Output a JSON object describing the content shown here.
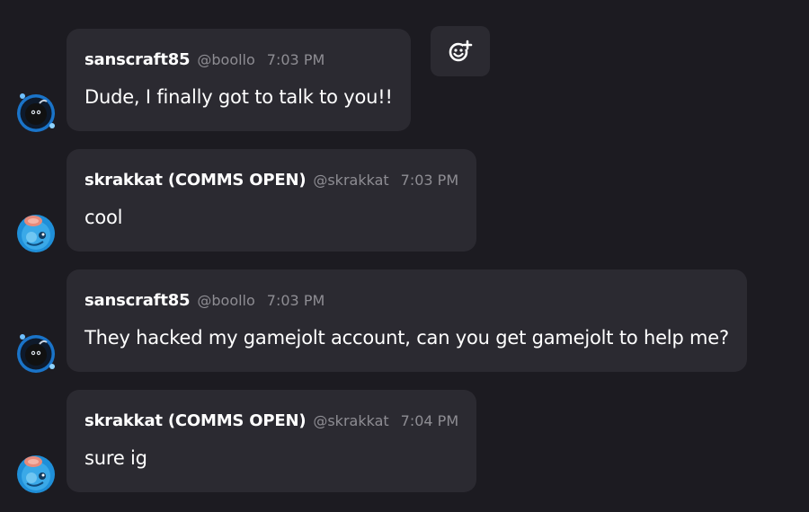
{
  "messages": [
    {
      "username": "sanscraft85",
      "handle": "@boollo",
      "time": "7:03 PM",
      "text": "Dude, I finally got to talk to you!!"
    },
    {
      "username": "skrakkat (COMMS OPEN)",
      "handle": "@skrakkat",
      "time": "7:03 PM",
      "text": "cool"
    },
    {
      "username": "sanscraft85",
      "handle": "@boollo",
      "time": "7:03 PM",
      "text": "They hacked my gamejolt account, can you get gamejolt to help me?"
    },
    {
      "username": "skrakkat (COMMS OPEN)",
      "handle": "@skrakkat",
      "time": "7:04 PM",
      "text": "sure ig"
    }
  ],
  "icons": {
    "add_reaction": "add-reaction-icon"
  },
  "colors": {
    "background": "#1c1b21",
    "bubble": "#2b2a31",
    "text": "#ffffff",
    "meta": "#8e8d93"
  }
}
